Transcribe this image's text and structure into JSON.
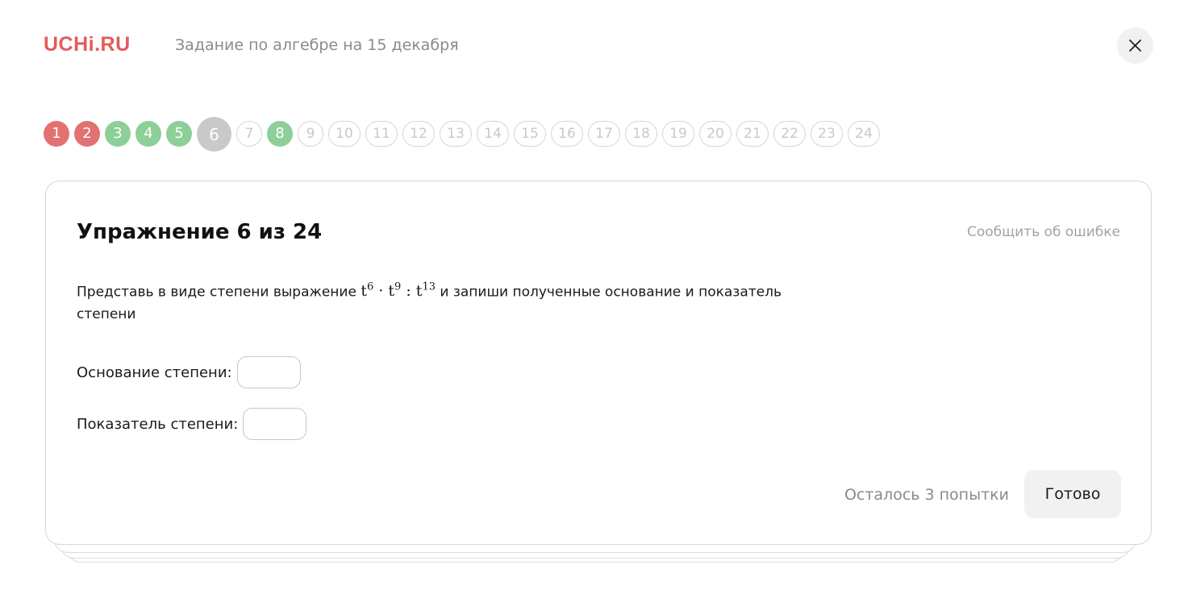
{
  "header": {
    "logo": "UCHi.RU",
    "title": "Задание по алгебре на 15 декабря"
  },
  "steps": [
    {
      "label": "1",
      "status": "wrong"
    },
    {
      "label": "2",
      "status": "wrong"
    },
    {
      "label": "3",
      "status": "correct"
    },
    {
      "label": "4",
      "status": "correct"
    },
    {
      "label": "5",
      "status": "correct"
    },
    {
      "label": "6",
      "status": "current"
    },
    {
      "label": "7",
      "status": "pending"
    },
    {
      "label": "8",
      "status": "correct"
    },
    {
      "label": "9",
      "status": "pending"
    },
    {
      "label": "10",
      "status": "pending"
    },
    {
      "label": "11",
      "status": "pending"
    },
    {
      "label": "12",
      "status": "pending"
    },
    {
      "label": "13",
      "status": "pending"
    },
    {
      "label": "14",
      "status": "pending"
    },
    {
      "label": "15",
      "status": "pending"
    },
    {
      "label": "16",
      "status": "pending"
    },
    {
      "label": "17",
      "status": "pending"
    },
    {
      "label": "18",
      "status": "pending"
    },
    {
      "label": "19",
      "status": "pending"
    },
    {
      "label": "20",
      "status": "pending"
    },
    {
      "label": "21",
      "status": "pending"
    },
    {
      "label": "22",
      "status": "pending"
    },
    {
      "label": "23",
      "status": "pending"
    },
    {
      "label": "24",
      "status": "pending"
    }
  ],
  "exercise": {
    "title": "Упражнение 6 из 24",
    "report_label": "Сообщить об ошибке",
    "text_before": "Представь в виде степени выражение ",
    "text_after": " и запиши полученные основание и показатель степени",
    "math": {
      "base": "t",
      "exp1": "6",
      "op1": "·",
      "exp2": "9",
      "op2": ":",
      "exp3": "13"
    },
    "base_label": "Основание степени:",
    "exponent_label": "Показатель степени:",
    "base_value": "",
    "exponent_value": ""
  },
  "footer": {
    "attempts": "Осталось 3 попытки",
    "done_label": "Готово"
  },
  "colors": {
    "brand": "#e55a5a",
    "wrong": "#e27272",
    "correct": "#8ccf98",
    "current": "#c9c9c9"
  }
}
